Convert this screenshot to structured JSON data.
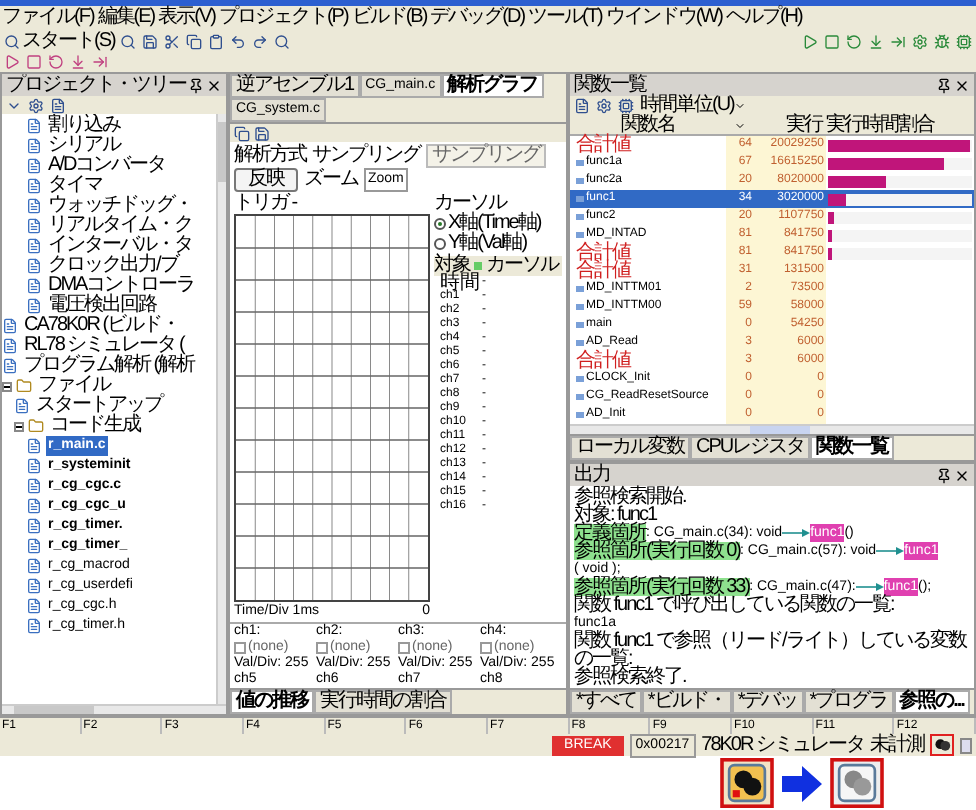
{
  "menu": [
    "ファイル(F)",
    "編集(E)",
    "表示(V)",
    "プロジェクト(P)",
    "ビルド(B)",
    "デバッグ(D)",
    "ツール(T)",
    "ウインドウ(W)",
    "ヘルプ(H)"
  ],
  "toolbar": {
    "start_button": "スタート(S)"
  },
  "project_tree": {
    "title": "プロジェクト・ツリー",
    "items": [
      {
        "children": [
          {
            "label": "割り込み"
          },
          {
            "label": "シリアル"
          },
          {
            "label": "A/Dコンバータ"
          },
          {
            "label": "タイマ"
          },
          {
            "label": "ウォッチドッグ・"
          },
          {
            "label": "リアルタイム・ク"
          },
          {
            "label": "インターバル・タ"
          },
          {
            "label": "クロック出力/ブ"
          },
          {
            "label": "DMAコントローラ"
          },
          {
            "label": "電圧検出回路"
          }
        ]
      },
      {
        "label": "CA78K0R (ビルド・"
      },
      {
        "label": "RL78 シミュレータ ("
      },
      {
        "label": "プログラム解析 (解析"
      },
      {
        "label": "ファイル",
        "expanded": true,
        "children": [
          {
            "label": "スタートアップ"
          },
          {
            "label": "コード生成",
            "expanded": true,
            "children": [
              {
                "label": "r_main.c",
                "selected": true,
                "bold": true
              },
              {
                "label": "r_systeminit",
                "selected": false,
                "bold": true
              },
              {
                "label": "r_cg_cgc.c",
                "selected": false,
                "bold": true
              },
              {
                "label": "r_cg_cgc_u",
                "selected": false,
                "bold": true
              },
              {
                "label": "r_cg_timer.",
                "selected": false,
                "bold": true
              },
              {
                "label": "r_cg_timer_",
                "selected": false,
                "bold": true
              },
              {
                "label": "r_cg_macrod",
                "selected": false,
                "bold": false
              },
              {
                "label": "r_cg_userdefi",
                "selected": false,
                "bold": false
              },
              {
                "label": "r_cg_cgc.h",
                "selected": false,
                "bold": false
              },
              {
                "label": "r_cg_timer.h",
                "selected": false,
                "bold": false
              }
            ]
          }
        ]
      }
    ]
  },
  "analysis_graph": {
    "tabs": [
      {
        "label": "逆アセンブル1",
        "selected": false
      },
      {
        "label": "CG_main.c",
        "selected": false
      },
      {
        "label": "解析グラフ",
        "selected": true
      },
      {
        "label": "CG_system.c",
        "selected": false
      }
    ],
    "method_label": "解析方式",
    "method_value": "サンプリング",
    "method_select": "サンプリング",
    "apply_button": "反映",
    "zoom_label": "ズーム",
    "zoom_value": "Zoom",
    "trigger": "トリガ -",
    "time_div": "Time/Div 1ms",
    "time_zero": "0",
    "cursor": {
      "title": "カーソル",
      "options": [
        {
          "label": "X軸(Time軸)",
          "selected": true
        },
        {
          "label": "Y軸(Val軸)",
          "selected": false
        }
      ]
    },
    "cursor_table": {
      "columns": [
        "対象",
        "カーソル"
      ],
      "rows": [
        [
          "時間",
          "-"
        ],
        [
          "ch1",
          "-"
        ],
        [
          "ch2",
          "-"
        ],
        [
          "ch3",
          "-"
        ],
        [
          "ch4",
          "-"
        ],
        [
          "ch5",
          "-"
        ],
        [
          "ch6",
          "-"
        ],
        [
          "ch7",
          "-"
        ],
        [
          "ch8",
          "-"
        ],
        [
          "ch9",
          "-"
        ],
        [
          "ch10",
          "-"
        ],
        [
          "ch11",
          "-"
        ],
        [
          "ch12",
          "-"
        ],
        [
          "ch13",
          "-"
        ],
        [
          "ch14",
          "-"
        ],
        [
          "ch15",
          "-"
        ],
        [
          "ch16",
          "-"
        ]
      ]
    },
    "channels": [
      {
        "name": "ch1:",
        "checked": false,
        "label": "(none)",
        "val_div": "Val/Div: 255"
      },
      {
        "name": "ch2:",
        "checked": false,
        "label": "(none)",
        "val_div": "Val/Div: 255"
      },
      {
        "name": "ch3:",
        "checked": false,
        "label": "(none)",
        "val_div": "Val/Div: 255"
      },
      {
        "name": "ch4:",
        "checked": false,
        "label": "(none)",
        "val_div": "Val/Div: 255"
      }
    ],
    "channels_next": [
      "ch5",
      "ch6",
      "ch7",
      "ch8"
    ],
    "bottom_tabs": [
      {
        "label": "値の推移",
        "selected": true
      },
      {
        "label": "実行時間の割合",
        "selected": false
      }
    ]
  },
  "function_list": {
    "title": "関数一覧",
    "unit_button": "時間単位(U)",
    "columns": [
      "関数名",
      "実行",
      "実行時間割合"
    ],
    "rows": [
      {
        "kind": "total",
        "name": "合計値",
        "count": "64",
        "time": "20029250",
        "level": 0.98,
        "selected": false
      },
      {
        "kind": "function",
        "name": "func1a",
        "count": "67",
        "time": "16615250",
        "level": 0.8,
        "selected": false
      },
      {
        "kind": "function",
        "name": "func2a",
        "count": "20",
        "time": "8020000",
        "level": 0.4,
        "selected": false
      },
      {
        "kind": "function",
        "name": "func1",
        "count": "34",
        "time": "3020000",
        "level": 0.13,
        "selected": true
      },
      {
        "kind": "function",
        "name": "func2",
        "count": "20",
        "time": "1107750",
        "level": 0.04,
        "selected": false
      },
      {
        "kind": "function",
        "name": "MD_INTAD",
        "count": "81",
        "time": "841750",
        "level": 0.03,
        "selected": false
      },
      {
        "kind": "total",
        "name": "合計値",
        "count": "81",
        "time": "841750",
        "level": 0.03,
        "selected": false
      },
      {
        "kind": "total",
        "name": "合計値",
        "count": "31",
        "time": "131500",
        "selected": false
      },
      {
        "kind": "function",
        "name": "MD_INTTM01",
        "count": "2",
        "time": "73500",
        "selected": false
      },
      {
        "kind": "function",
        "name": "MD_INTTM00",
        "count": "59",
        "time": "58000",
        "selected": false
      },
      {
        "kind": "function",
        "name": "main",
        "count": "0",
        "time": "54250",
        "selected": false
      },
      {
        "kind": "function",
        "name": "AD_Read",
        "count": "3",
        "time": "6000",
        "selected": false
      },
      {
        "kind": "total",
        "name": "合計値",
        "count": "3",
        "time": "6000",
        "selected": false
      },
      {
        "kind": "function",
        "name": "CLOCK_Init",
        "count": "0",
        "time": "0",
        "selected": false
      },
      {
        "kind": "function",
        "name": "CG_ReadResetSource",
        "count": "0",
        "time": "0",
        "selected": false
      },
      {
        "kind": "function",
        "name": "AD_Init",
        "count": "0",
        "time": "0",
        "selected": false
      }
    ],
    "tabs": [
      {
        "label": "ローカル変数",
        "selected": false
      },
      {
        "label": "CPUレジスタ",
        "selected": false
      },
      {
        "label": "関数一覧",
        "selected": true
      }
    ]
  },
  "output": {
    "title": "出力",
    "lines": [
      [
        {
          "kind": "text",
          "text": "参照検索開始."
        }
      ],
      [
        {
          "kind": "text",
          "text": "対象: func1"
        }
      ],
      [
        {
          "kind": "match",
          "text": "定義箇所"
        },
        {
          "kind": "text",
          "text": ": CG_main.c(34): void"
        },
        {
          "kind": "arrow"
        },
        {
          "kind": "name",
          "text": "func1"
        },
        {
          "kind": "text",
          "text": "()"
        }
      ],
      [
        {
          "kind": "match",
          "text": "参照箇所(実行回数 0)"
        },
        {
          "kind": "text",
          "text": ": CG_main.c(57): void"
        },
        {
          "kind": "arrow"
        },
        {
          "kind": "name",
          "text": "func1"
        },
        {
          "kind": "text",
          "text": "( void );"
        }
      ],
      [
        {
          "kind": "match",
          "text": "参照箇所(実行回数 33)"
        },
        {
          "kind": "text",
          "text": ": CG_main.c(47):"
        },
        {
          "kind": "arrow"
        },
        {
          "kind": "name",
          "text": "func1"
        },
        {
          "kind": "text",
          "text": "();"
        }
      ],
      [
        {
          "kind": "text",
          "text": "関数 func1 で呼び出している関数の一覧:"
        }
      ],
      [
        {
          "kind": "text",
          "text": "func1a"
        }
      ],
      [
        {
          "kind": "text",
          "text": "関数 func1 で参照（リード/ライト）している変数の一覧:"
        }
      ],
      [
        {
          "kind": "text",
          "text": "参照検索終了."
        }
      ]
    ],
    "tabs": [
      {
        "label": "*すべて",
        "selected": false
      },
      {
        "label": "*ビルド・",
        "selected": false
      },
      {
        "label": "*デバッ",
        "selected": false
      },
      {
        "label": "*プログラ",
        "selected": false
      },
      {
        "label": "参照の...",
        "selected": true
      }
    ]
  },
  "function_keys": [
    "F1",
    "F2",
    "F3",
    "F4",
    "F5",
    "F6",
    "F7",
    "F8",
    "F9",
    "F10",
    "F11",
    "F12"
  ],
  "status_bar": {
    "state": "BREAK",
    "address": "0x00217",
    "debugger": "78K0R シミュレータ",
    "measurement": "未計測"
  }
}
